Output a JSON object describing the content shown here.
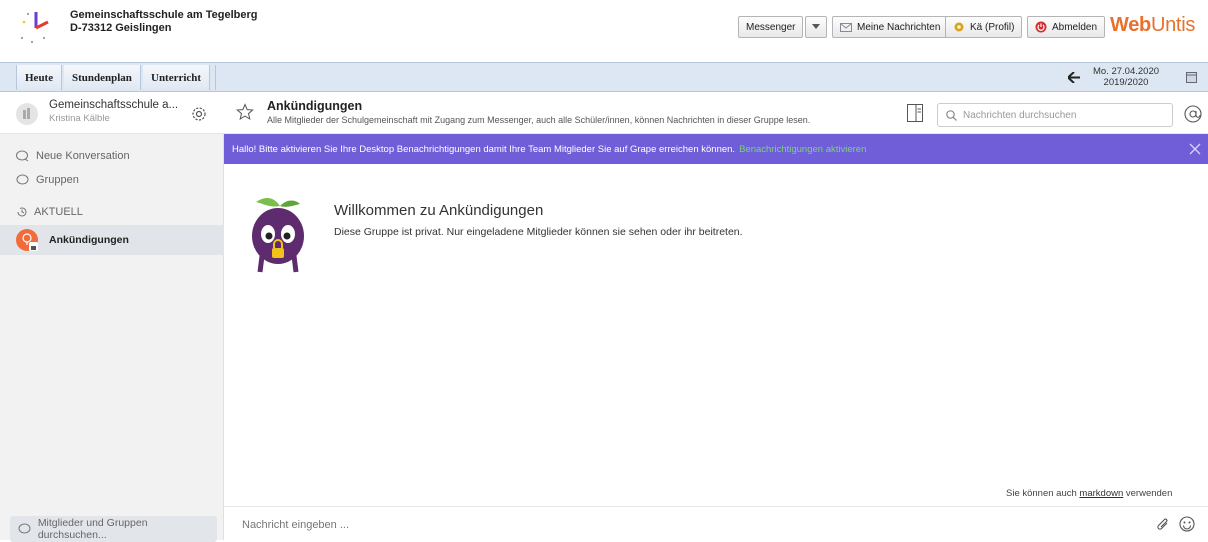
{
  "header": {
    "school_line1": "Gemeinschaftsschule am Tegelberg",
    "school_line2": "D-73312 Geislingen",
    "messenger_label": "Messenger",
    "messages_label": "Meine Nachrichten",
    "profile_label": "Kä (Profil)",
    "logout_label": "Abmelden",
    "brand_web": "Web",
    "brand_untis": "Untis"
  },
  "nav": {
    "tabs": [
      "Heute",
      "Stundenplan",
      "Unterricht"
    ],
    "date": "Mo. 27.04.2020",
    "school_year": "2019/2020"
  },
  "sidebar": {
    "group_name": "Gemeinschaftsschule a...",
    "user_name": "Kristina Kälble",
    "new_conversation": "Neue Konversation",
    "groups": "Gruppen",
    "current_section": "AKTUELL",
    "active_channel": "Ankündigungen",
    "search_placeholder": "Mitglieder und Gruppen durchsuchen..."
  },
  "channel": {
    "title": "Ankündigungen",
    "description": "Alle Mitglieder der Schulgemeinschaft mit Zugang zum Messenger, auch alle Schüler/innen, können Nachrichten in dieser Gruppe lesen.",
    "search_placeholder": "Nachrichten durchsuchen"
  },
  "banner": {
    "text": "Hallo! Bitte aktivieren Sie Ihre Desktop Benachrichtigungen damit Ihre Team Mitglieder Sie auf Grape erreichen können.",
    "link": "Benachrichtigungen aktivieren"
  },
  "welcome": {
    "title": "Willkommen zu Ankündigungen",
    "subtitle": "Diese Gruppe ist privat. Nur eingeladene Mitglieder können sie sehen oder ihr beitreten."
  },
  "compose": {
    "markdown_prefix": "Sie können auch",
    "markdown_link": "markdown",
    "markdown_suffix": "verwenden",
    "placeholder": "Nachricht eingeben ..."
  },
  "colors": {
    "banner": "#6f5ed8",
    "banner_link": "#7ad37a",
    "brand": "#e8712c",
    "nav_bg": "#dce7f3",
    "channel_avatar": "#f26b3a"
  }
}
